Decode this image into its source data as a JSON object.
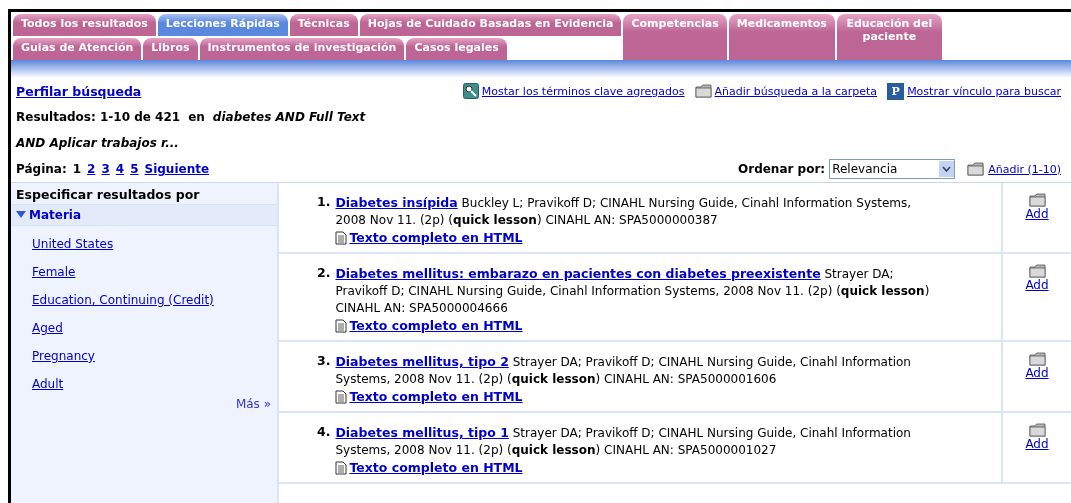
{
  "tabs": {
    "rows": [
      [
        {
          "label": "Todos los resultados",
          "selected": false
        },
        {
          "label": "Lecciones Rápidas",
          "selected": true
        },
        {
          "label": "Técnicas",
          "selected": false
        },
        {
          "label": "Hojas de Cuidado Basadas en Evidencia",
          "selected": false
        },
        {
          "label": "Competencias",
          "selected": false
        },
        {
          "label": "Medicamentos",
          "selected": false
        },
        {
          "label": "Educación del paciente",
          "selected": false
        }
      ],
      [
        {
          "label": "Guias de Atención",
          "selected": false
        },
        {
          "label": "Libros",
          "selected": false
        },
        {
          "label": "Instrumentos de investigación",
          "selected": false
        },
        {
          "label": "Casos legales",
          "selected": false
        }
      ]
    ]
  },
  "toolbar": {
    "refine_link": "Perfilar búsqueda",
    "actions": [
      {
        "kind": "terms",
        "label": "Mostar los términos clave agregados"
      },
      {
        "kind": "folder",
        "label": "Añadir búsqueda a la carpeta"
      },
      {
        "kind": "persistent",
        "icon_letter": "P",
        "label": "Mostrar vínculo para buscar"
      }
    ]
  },
  "summary": {
    "results": "Resultados: 1-10 de 421",
    "connector": "en",
    "query": "diabetes AND Full Text",
    "query_cont": "AND Aplicar trabajos r..."
  },
  "pagination": {
    "label": "Página:",
    "pages": [
      {
        "label": "1",
        "selected": true
      },
      {
        "label": "2",
        "selected": false
      },
      {
        "label": "3",
        "selected": false
      },
      {
        "label": "4",
        "selected": false
      },
      {
        "label": "5",
        "selected": false
      }
    ],
    "next": "Siguiente"
  },
  "sort": {
    "label": "Ordenar por:",
    "value": "Relevancia",
    "add_all": "Añadir (1-10)"
  },
  "sidebar": {
    "title": "Especificar resultados por",
    "facet": {
      "label": "Materia",
      "expanded": true,
      "items": [
        "United States",
        "Female",
        "Education, Continuing (Credit)",
        "Aged",
        "Pregnancy",
        "Adult"
      ]
    },
    "more": "Más »"
  },
  "results": [
    {
      "number": "1.",
      "title": "Diabetes insípida",
      "citation": "Buckley L; Pravikoff D; CINAHL Nursing Guide, Cinahl Information Systems, 2008 Nov 11. (2p) (**quick lesson**) CINAHL AN: SPA5000000387",
      "fulltext": "Texto completo en HTML",
      "add": "Add"
    },
    {
      "number": "2.",
      "title": "Diabetes mellitus: embarazo en pacientes con diabetes preexistente",
      "citation": "Strayer DA; Pravikoff D; CINAHL Nursing Guide, Cinahl Information Systems, 2008 Nov 11. (2p) (**quick lesson**) CINAHL AN: SPA5000004666",
      "fulltext": "Texto completo en HTML",
      "add": "Add"
    },
    {
      "number": "3.",
      "title": "Diabetes mellitus, tipo 2",
      "citation": "Strayer DA; Pravikoff D; CINAHL Nursing Guide, Cinahl Information Systems, 2008 Nov 11. (2p) (**quick lesson**) CINAHL AN: SPA5000001606",
      "fulltext": "Texto completo en HTML",
      "add": "Add"
    },
    {
      "number": "4.",
      "title": "Diabetes mellitus, tipo 1",
      "citation": "Strayer DA; Pravikoff D; CINAHL Nursing Guide, Cinahl Information Systems, 2008 Nov 11. (2p) (**quick lesson**) CINAHL AN: SPA5000001027",
      "fulltext": "Texto completo en HTML",
      "add": "Add"
    }
  ]
}
